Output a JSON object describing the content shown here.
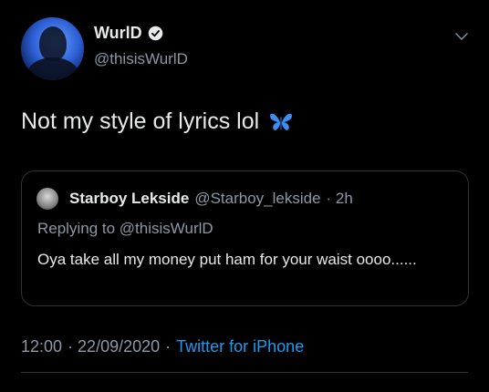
{
  "author": {
    "name": "WurlD",
    "handle": "@thisisWurlD"
  },
  "tweet": {
    "text": "Not my style of lyrics lol",
    "emoji": "butterfly-icon"
  },
  "quoted": {
    "name": "Starboy Lekside",
    "handle": "@Starboy_lekside",
    "time": "· 2h",
    "replying_to_label": "Replying to",
    "replying_to_handle": "@thisisWurlD",
    "text": "Oya take all my money put ham for your waist oooo......"
  },
  "footer": {
    "time": "12:00",
    "date": "· 22/09/2020",
    "sep": "·",
    "source": "Twitter for iPhone"
  },
  "colors": {
    "background": "#000000",
    "text": "#e7e9ea",
    "secondary": "#8b98a5",
    "accent": "#1d9bf0",
    "border": "#2f3336"
  }
}
